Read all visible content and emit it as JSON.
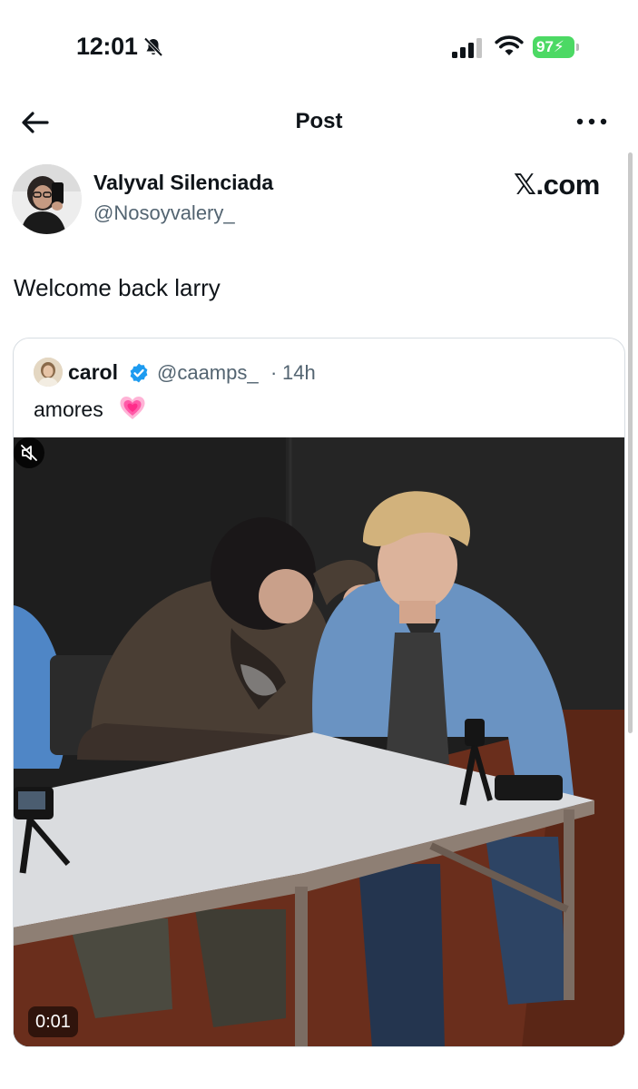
{
  "status_bar": {
    "time": "12:01",
    "battery": "97"
  },
  "nav": {
    "title": "Post"
  },
  "author": {
    "name": "Valyval Silenciada",
    "handle": "@Nosoyvalery_"
  },
  "brand": "𝕏.com",
  "post": {
    "text": "Welcome back larry"
  },
  "quote": {
    "name": "carol",
    "handle": "@caamps_",
    "separator": "·",
    "time": "14h",
    "text": "amores",
    "video_time": "0:01"
  },
  "icons": {
    "bell": "bell-slash-icon",
    "signal": "cellular-signal-icon",
    "wifi": "wifi-icon",
    "battery": "battery-charging-icon",
    "back": "arrow-left-icon",
    "more": "more-horizontal-icon",
    "verified": "verified-badge-icon",
    "heart": "growing-heart-icon",
    "mute": "speaker-muted-icon"
  },
  "colors": {
    "verified": "#1d9bf0",
    "battery": "#4cd964",
    "secondary_text": "#536471",
    "heart": "#ff5aa8"
  }
}
